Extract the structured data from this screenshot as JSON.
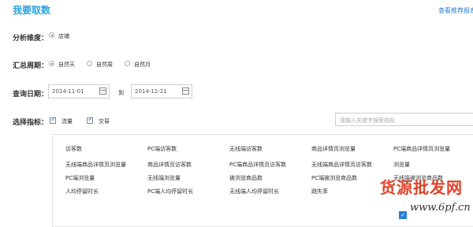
{
  "page": {
    "title": "我要取数",
    "top_link": "查看推荐报表"
  },
  "dimension": {
    "label": "分析维度：",
    "option": "店铺",
    "selected": true
  },
  "period": {
    "label": "汇总周期：",
    "options": [
      "自然天",
      "自然周",
      "自然月"
    ],
    "selected": "自然天"
  },
  "dates": {
    "label": "查询日期：",
    "start": "2014-11-01",
    "separator": "到",
    "end": "2014-11-21"
  },
  "metrics": {
    "label": "选择指标：",
    "checks": [
      "流量",
      "交易"
    ],
    "search_placeholder": "请输入关键字搜索指标"
  },
  "metric_grid": [
    [
      "访客数",
      "PC端访客数",
      "无线端访客数",
      "商品详情页浏览量",
      "PC端商品详情页浏览量"
    ],
    [
      "无线端商品详情页浏览量",
      "商品详情页访客数",
      "PC端商品详情页访客数",
      "无线端商品详情页访客数",
      "浏览量"
    ],
    [
      "PC端浏览量",
      "无线端浏览量",
      "被浏览商品数",
      "PC端被浏览商品数",
      "无线端被浏览商品数"
    ],
    [
      "人均停留时长",
      "PC端人均停留时长",
      "无线端人均停留时长",
      "跳失率",
      ""
    ]
  ],
  "watermark": {
    "text": "货源批发网",
    "url": "www.6pf.cn"
  }
}
